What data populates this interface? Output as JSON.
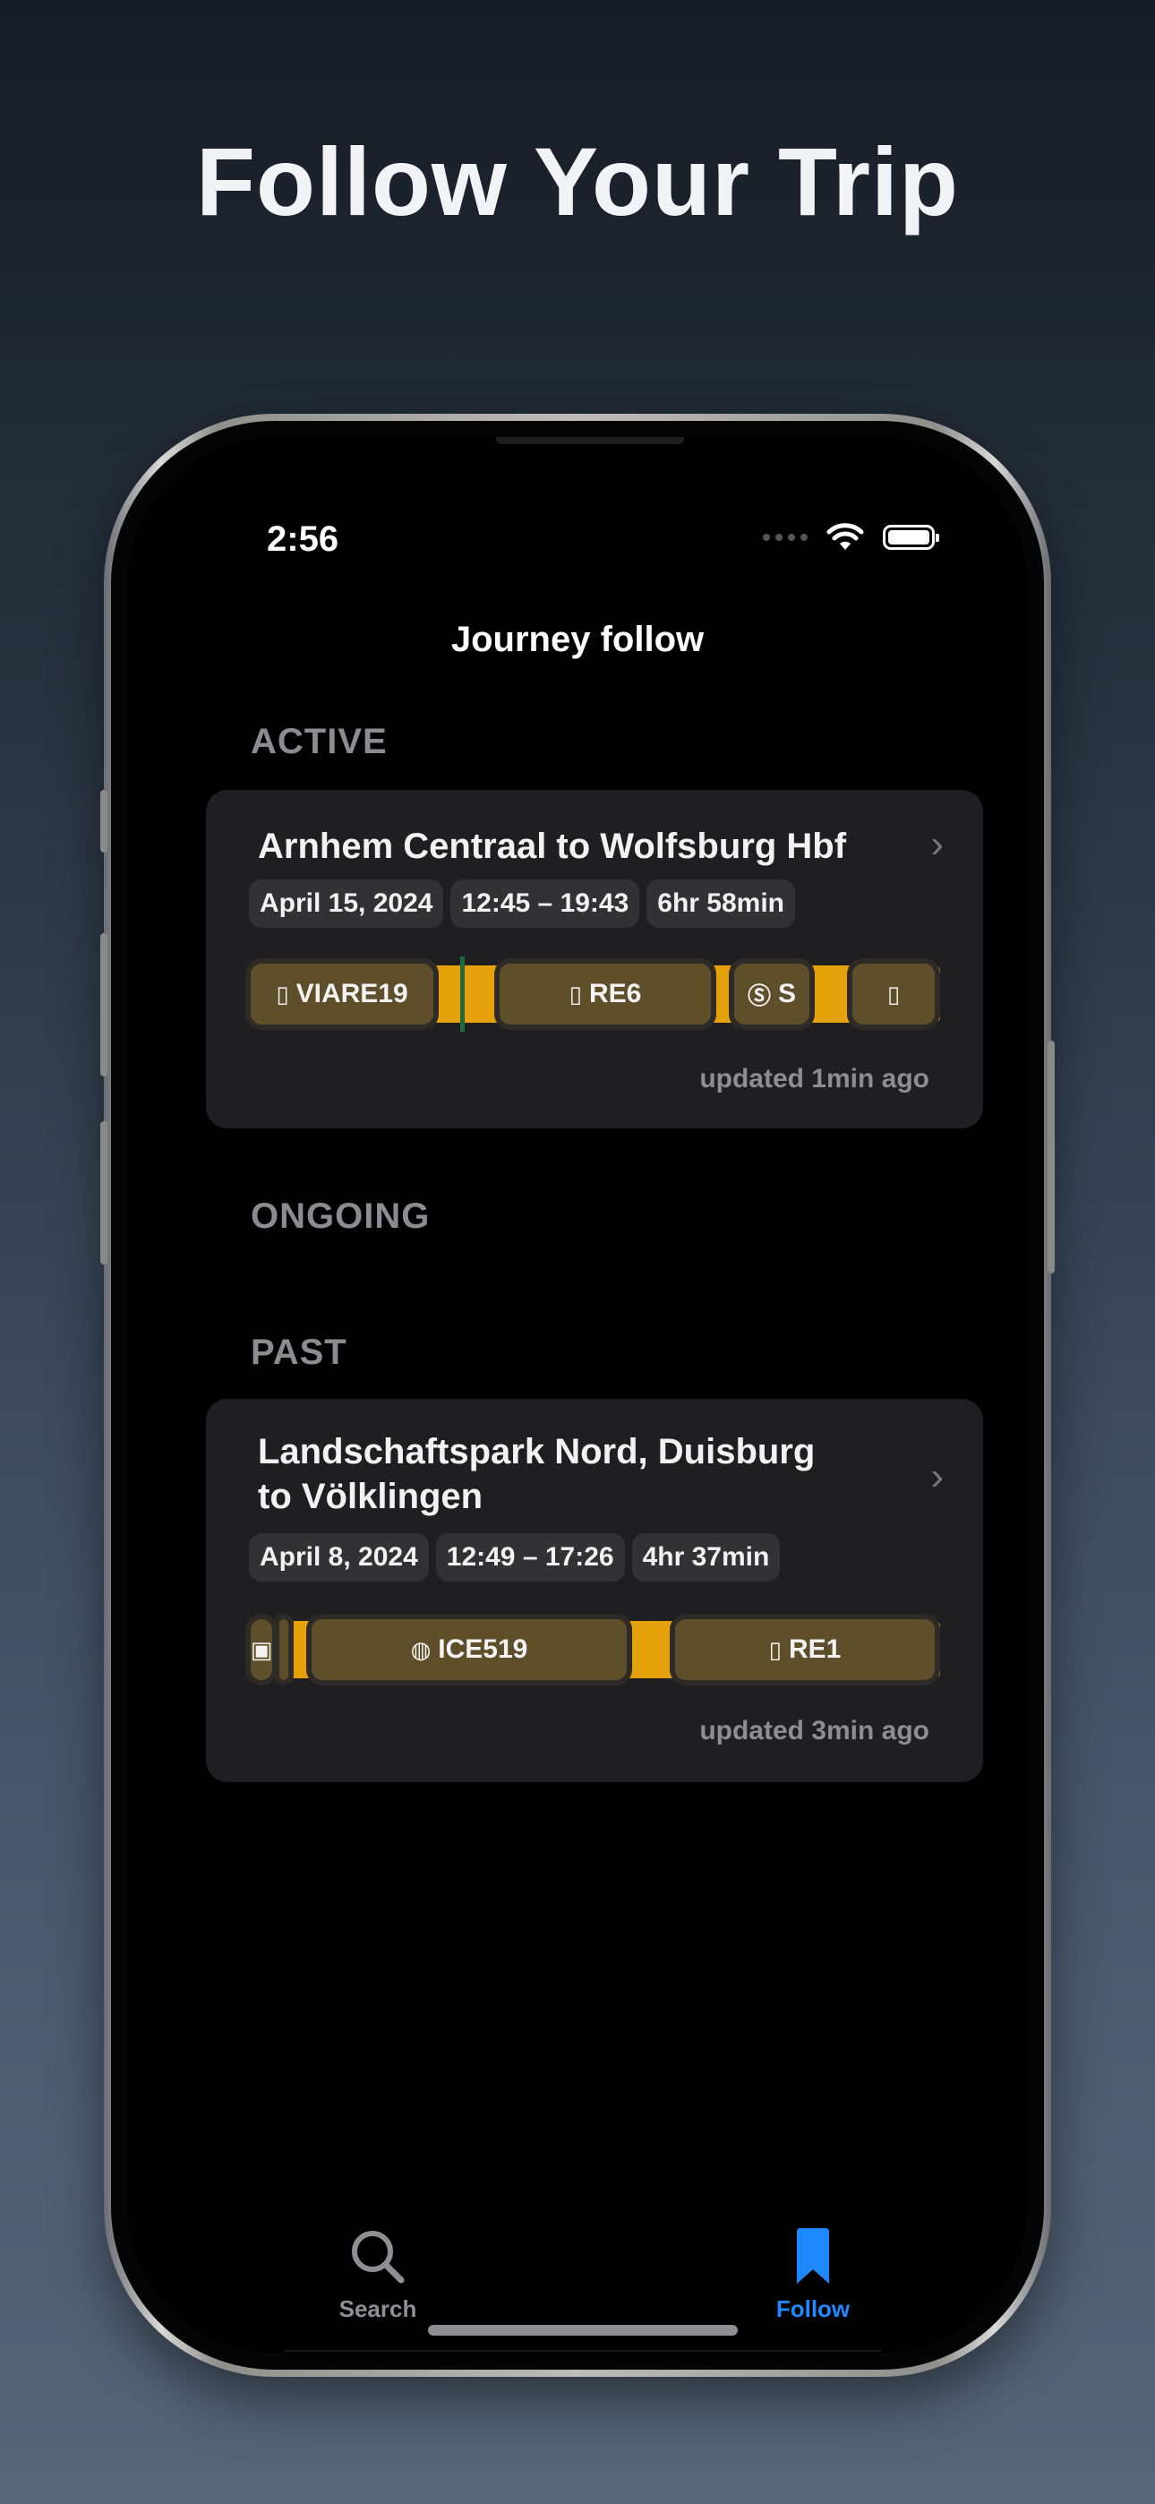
{
  "hero": {
    "title": "Follow Your Trip"
  },
  "status_bar": {
    "time": "2:56"
  },
  "nav": {
    "title": "Journey follow"
  },
  "sections": {
    "active": "ACTIVE",
    "ongoing": "ONGOING",
    "past": "PAST"
  },
  "active_journey": {
    "title": "Arnhem Centraal to Wolfsburg Hbf",
    "date": "April 15, 2024",
    "time_range": "12:45 – 19:43",
    "duration": "6hr 58min",
    "segments": [
      {
        "label": "VIARE19",
        "icon": "train-icon"
      },
      {
        "label": "RE6",
        "icon": "train-icon"
      },
      {
        "label": "S",
        "icon": "sbahn-icon"
      },
      {
        "label": "",
        "icon": "train-icon"
      }
    ],
    "updated": "updated 1min ago"
  },
  "past_journey": {
    "title_line1": "Landschaftspark Nord, Duisburg",
    "title_line2": "to Völklingen",
    "date": "April 8, 2024",
    "time_range": "12:49 – 17:26",
    "duration": "4hr 37min",
    "segments": [
      {
        "label": "",
        "icon": "tram-icon"
      },
      {
        "label": "ICE519",
        "icon": "ice-train-icon"
      },
      {
        "label": "RE1",
        "icon": "train-icon"
      }
    ],
    "updated": "updated 3min ago"
  },
  "tabs": {
    "search": "Search",
    "follow": "Follow"
  },
  "colors": {
    "accent": "#1e88ff",
    "timeline": "#e4a10a",
    "segment": "#5e4f2a",
    "card": "#1f1f21"
  }
}
